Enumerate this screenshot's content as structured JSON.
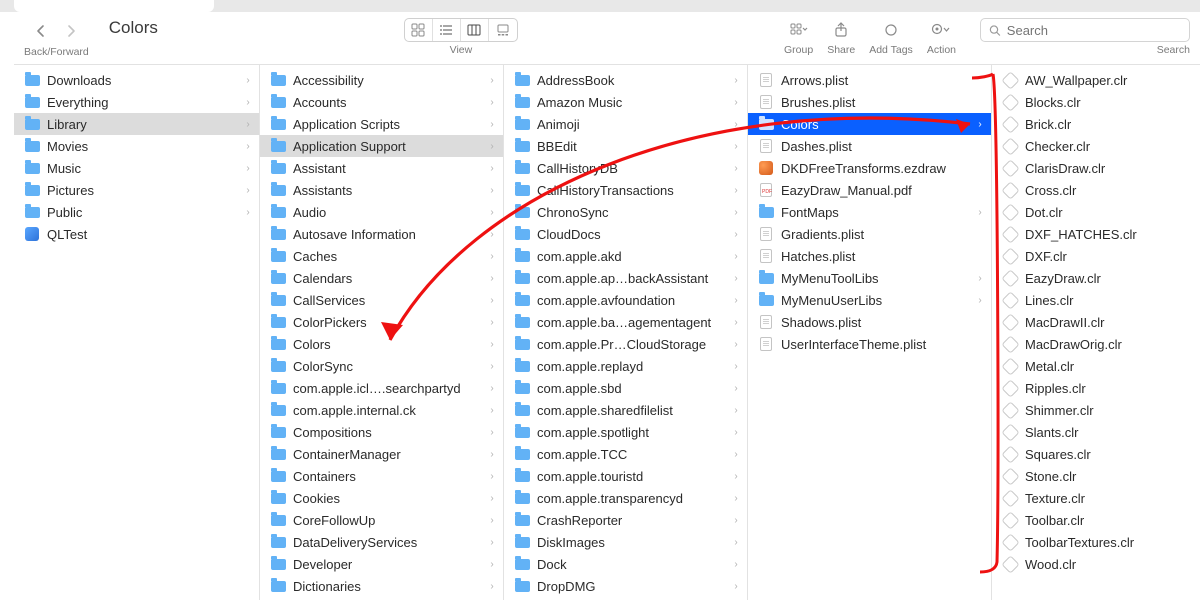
{
  "toolbar": {
    "back_forward_label": "Back/Forward",
    "title": "Colors",
    "view_label": "View",
    "group_label": "Group",
    "share_label": "Share",
    "tags_label": "Add Tags",
    "action_label": "Action",
    "search_label": "Search",
    "search_placeholder": "Search"
  },
  "columns": [
    {
      "items": [
        {
          "name": "Downloads",
          "type": "folder",
          "chevron": true
        },
        {
          "name": "Everything",
          "type": "folder",
          "chevron": true
        },
        {
          "name": "Library",
          "type": "folder",
          "chevron": true,
          "selected_gray": true
        },
        {
          "name": "Movies",
          "type": "folder",
          "chevron": true
        },
        {
          "name": "Music",
          "type": "folder",
          "chevron": true
        },
        {
          "name": "Pictures",
          "type": "folder",
          "chevron": true
        },
        {
          "name": "Public",
          "type": "folder",
          "chevron": true
        },
        {
          "name": "QLTest",
          "type": "app",
          "chevron": false
        }
      ]
    },
    {
      "items": [
        {
          "name": "Accessibility",
          "type": "folder",
          "chevron": true
        },
        {
          "name": "Accounts",
          "type": "folder",
          "chevron": true
        },
        {
          "name": "Application Scripts",
          "type": "folder",
          "chevron": true
        },
        {
          "name": "Application Support",
          "type": "folder",
          "chevron": true,
          "selected_gray": true
        },
        {
          "name": "Assistant",
          "type": "folder",
          "chevron": true
        },
        {
          "name": "Assistants",
          "type": "folder",
          "chevron": true
        },
        {
          "name": "Audio",
          "type": "folder",
          "chevron": true
        },
        {
          "name": "Autosave Information",
          "type": "folder",
          "chevron": true
        },
        {
          "name": "Caches",
          "type": "folder",
          "chevron": true
        },
        {
          "name": "Calendars",
          "type": "folder",
          "chevron": true
        },
        {
          "name": "CallServices",
          "type": "folder",
          "chevron": true
        },
        {
          "name": "ColorPickers",
          "type": "folder",
          "chevron": true
        },
        {
          "name": "Colors",
          "type": "folder",
          "chevron": true
        },
        {
          "name": "ColorSync",
          "type": "folder",
          "chevron": true
        },
        {
          "name": "com.apple.icl….searchpartyd",
          "type": "folder",
          "chevron": true
        },
        {
          "name": "com.apple.internal.ck",
          "type": "folder",
          "chevron": true
        },
        {
          "name": "Compositions",
          "type": "folder",
          "chevron": true
        },
        {
          "name": "ContainerManager",
          "type": "folder",
          "chevron": true
        },
        {
          "name": "Containers",
          "type": "folder",
          "chevron": true
        },
        {
          "name": "Cookies",
          "type": "folder",
          "chevron": true
        },
        {
          "name": "CoreFollowUp",
          "type": "folder",
          "chevron": true
        },
        {
          "name": "DataDeliveryServices",
          "type": "folder",
          "chevron": true
        },
        {
          "name": "Developer",
          "type": "folder",
          "chevron": true
        },
        {
          "name": "Dictionaries",
          "type": "folder",
          "chevron": true
        }
      ]
    },
    {
      "items": [
        {
          "name": "AddressBook",
          "type": "folder",
          "chevron": true
        },
        {
          "name": "Amazon Music",
          "type": "folder",
          "chevron": true
        },
        {
          "name": "Animoji",
          "type": "folder",
          "chevron": true
        },
        {
          "name": "BBEdit",
          "type": "folder",
          "chevron": true
        },
        {
          "name": "CallHistoryDB",
          "type": "folder",
          "chevron": true
        },
        {
          "name": "CallHistoryTransactions",
          "type": "folder",
          "chevron": true
        },
        {
          "name": "ChronoSync",
          "type": "folder",
          "chevron": true
        },
        {
          "name": "CloudDocs",
          "type": "folder",
          "chevron": true
        },
        {
          "name": "com.apple.akd",
          "type": "folder",
          "chevron": true
        },
        {
          "name": "com.apple.ap…backAssistant",
          "type": "folder",
          "chevron": true
        },
        {
          "name": "com.apple.avfoundation",
          "type": "folder",
          "chevron": true
        },
        {
          "name": "com.apple.ba…agementagent",
          "type": "folder",
          "chevron": true
        },
        {
          "name": "com.apple.Pr…CloudStorage",
          "type": "folder",
          "chevron": true
        },
        {
          "name": "com.apple.replayd",
          "type": "folder",
          "chevron": true
        },
        {
          "name": "com.apple.sbd",
          "type": "folder",
          "chevron": true
        },
        {
          "name": "com.apple.sharedfilelist",
          "type": "folder",
          "chevron": true
        },
        {
          "name": "com.apple.spotlight",
          "type": "folder",
          "chevron": true
        },
        {
          "name": "com.apple.TCC",
          "type": "folder",
          "chevron": true
        },
        {
          "name": "com.apple.touristd",
          "type": "folder",
          "chevron": true
        },
        {
          "name": "com.apple.transparencyd",
          "type": "folder",
          "chevron": true
        },
        {
          "name": "CrashReporter",
          "type": "folder",
          "chevron": true
        },
        {
          "name": "DiskImages",
          "type": "folder",
          "chevron": true
        },
        {
          "name": "Dock",
          "type": "folder",
          "chevron": true
        },
        {
          "name": "DropDMG",
          "type": "folder",
          "chevron": true
        }
      ]
    },
    {
      "items": [
        {
          "name": "Arrows.plist",
          "type": "doc",
          "chevron": false
        },
        {
          "name": "Brushes.plist",
          "type": "doc",
          "chevron": false
        },
        {
          "name": "Colors",
          "type": "folder",
          "chevron": true,
          "selected": true
        },
        {
          "name": "Dashes.plist",
          "type": "doc",
          "chevron": false
        },
        {
          "name": "DKDFreeTransforms.ezdraw",
          "type": "draw",
          "chevron": false
        },
        {
          "name": "EazyDraw_Manual.pdf",
          "type": "pdf",
          "chevron": false
        },
        {
          "name": "FontMaps",
          "type": "folder",
          "chevron": true
        },
        {
          "name": "Gradients.plist",
          "type": "doc",
          "chevron": false
        },
        {
          "name": "Hatches.plist",
          "type": "doc",
          "chevron": false
        },
        {
          "name": "MyMenuToolLibs",
          "type": "folder",
          "chevron": true
        },
        {
          "name": "MyMenuUserLibs",
          "type": "folder",
          "chevron": true
        },
        {
          "name": "Shadows.plist",
          "type": "doc",
          "chevron": false
        },
        {
          "name": "UserInterfaceTheme.plist",
          "type": "doc",
          "chevron": false
        }
      ]
    },
    {
      "items": [
        {
          "name": "AW_Wallpaper.clr",
          "type": "clr"
        },
        {
          "name": "Blocks.clr",
          "type": "clr"
        },
        {
          "name": "Brick.clr",
          "type": "clr"
        },
        {
          "name": "Checker.clr",
          "type": "clr"
        },
        {
          "name": "ClarisDraw.clr",
          "type": "clr"
        },
        {
          "name": "Cross.clr",
          "type": "clr"
        },
        {
          "name": "Dot.clr",
          "type": "clr"
        },
        {
          "name": "DXF_HATCHES.clr",
          "type": "clr"
        },
        {
          "name": "DXF.clr",
          "type": "clr"
        },
        {
          "name": "EazyDraw.clr",
          "type": "clr"
        },
        {
          "name": "Lines.clr",
          "type": "clr"
        },
        {
          "name": "MacDrawII.clr",
          "type": "clr"
        },
        {
          "name": "MacDrawOrig.clr",
          "type": "clr"
        },
        {
          "name": "Metal.clr",
          "type": "clr"
        },
        {
          "name": "Ripples.clr",
          "type": "clr"
        },
        {
          "name": "Shimmer.clr",
          "type": "clr"
        },
        {
          "name": "Slants.clr",
          "type": "clr"
        },
        {
          "name": "Squares.clr",
          "type": "clr"
        },
        {
          "name": "Stone.clr",
          "type": "clr"
        },
        {
          "name": "Texture.clr",
          "type": "clr"
        },
        {
          "name": "Toolbar.clr",
          "type": "clr"
        },
        {
          "name": "ToolbarTextures.clr",
          "type": "clr"
        },
        {
          "name": "Wood.clr",
          "type": "clr"
        }
      ]
    }
  ]
}
